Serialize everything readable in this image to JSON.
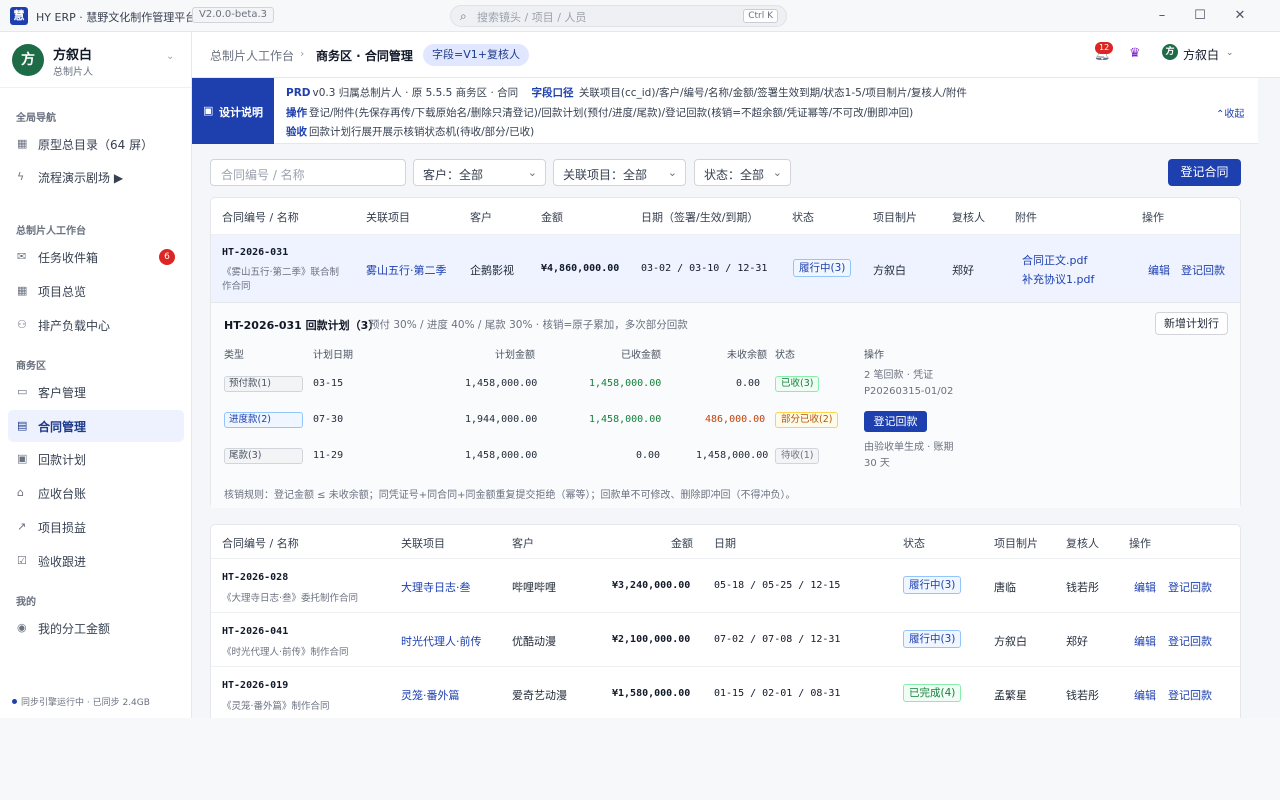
{
  "titlebar": {
    "logo": "慧",
    "title": "HY ERP · 慧野文化制作管理平台",
    "version": "V2.0.0-beta.3",
    "search_placeholder": "搜索镜头 / 项目 / 人员",
    "search_shortcut": "Ctrl K"
  },
  "sidebar": {
    "user": {
      "avatar": "方",
      "name": "方叙白",
      "role": "总制片人"
    },
    "sections": [
      {
        "title": "全局导航",
        "items": [
          {
            "icon": "grid-icon",
            "label": "原型总目录（64 屏）"
          },
          {
            "icon": "bolt-icon",
            "label": "流程演示剧场 ▶"
          }
        ]
      },
      {
        "title": "总制片人工作台",
        "items": [
          {
            "icon": "inbox-icon",
            "label": "任务收件箱",
            "badge": "6"
          },
          {
            "icon": "grid-icon",
            "label": "项目总览"
          },
          {
            "icon": "users-icon",
            "label": "排产负载中心"
          }
        ]
      },
      {
        "title": "商务区",
        "items": [
          {
            "icon": "customer-icon",
            "label": "客户管理"
          },
          {
            "icon": "contract-icon",
            "label": "合同管理",
            "active": true
          },
          {
            "icon": "calendar-icon",
            "label": "回款计划"
          },
          {
            "icon": "bank-icon",
            "label": "应收台账"
          },
          {
            "icon": "trend-icon",
            "label": "项目损益"
          },
          {
            "icon": "check-icon",
            "label": "验收跟进"
          }
        ]
      },
      {
        "title": "我的",
        "items": [
          {
            "icon": "coin-icon",
            "label": "我的分工金额"
          }
        ]
      }
    ],
    "sync_status": "同步引擎运行中 · 已同步 2.4GB"
  },
  "header": {
    "breadcrumb_parent": "总制片人工作台",
    "breadcrumb_current": "商务区 · 合同管理",
    "tag": "字段=V1+复核人",
    "notification_count": "12",
    "user_avatar": "方",
    "user_name": "方叙白"
  },
  "banner": {
    "label": "设计说明",
    "line1_key": "PRD",
    "line1": "v0.3 归属总制片人 · 原 5.5.5 商务区 · 合同",
    "line1b_key": "字段口径",
    "line1b": "关联项目(cc_id)/客户/编号/名称/金额/签署生效到期/状态1-5/项目制片/复核人/附件",
    "line2_key": "操作",
    "line2": "登记/附件(先保存再传/下载原始名/删除只清登记)/回款计划(预付/进度/尾款)/登记回款(核销=不超余额/凭证幂等/不可改/删即冲回)",
    "line3_key": "验收",
    "line3": "回款计划行展开展示核销状态机(待收/部分/已收)",
    "collapse": "收起"
  },
  "filters": {
    "search_placeholder": "合同编号 / 名称",
    "customer": "客户：全部",
    "project": "关联项目：全部",
    "status": "状态：全部",
    "add_button": "登记合同"
  },
  "table1": {
    "headers": [
      "合同编号 / 名称",
      "关联项目",
      "客户",
      "金额",
      "日期（签署/生效/到期）",
      "状态",
      "项目制片",
      "复核人",
      "附件",
      "操作"
    ],
    "row": {
      "id": "HT-2026-031",
      "name": "《雾山五行·第二季》联合制作合同",
      "project": "雾山五行·第二季",
      "customer": "企鹅影视",
      "amount": "¥4,860,000.00",
      "dates": "03-02 / 03-10 / 12-31",
      "status": "履行中(3)",
      "producer": "方叙白",
      "reviewer": "郑好",
      "attachments": [
        "合同正文.pdf",
        "补充协议1.pdf"
      ],
      "edit": "编辑",
      "register": "登记回款"
    }
  },
  "plan": {
    "title": "HT-2026-031 回款计划（3）",
    "note": "预付 30% / 进度 40% / 尾款 30% · 核销=原子累加，多次部分回款",
    "add_button": "新增计划行",
    "headers": [
      "类型",
      "计划日期",
      "计划金额",
      "已收金额",
      "未收余额",
      "状态",
      "操作"
    ],
    "rows": [
      {
        "type": "预付款(1)",
        "date": "03-15",
        "planned": "1,458,000.00",
        "received": "1,458,000.00",
        "remaining": "0.00",
        "status": "已收(3)",
        "op_line1": "2 笔回款 · 凭证",
        "op_line2": "P20260315-01/02"
      },
      {
        "type": "进度款(2)",
        "date": "07-30",
        "planned": "1,944,000.00",
        "received": "1,458,000.00",
        "remaining": "486,000.00",
        "status": "部分已收(2)",
        "op_button": "登记回款"
      },
      {
        "type": "尾款(3)",
        "date": "11-29",
        "planned": "1,458,000.00",
        "received": "0.00",
        "remaining": "1,458,000.00",
        "status": "待收(1)",
        "op_line1": "由验收单生成 · 账期",
        "op_line2": "30 天"
      }
    ],
    "rule": "核销规则：登记金额 ≤ 未收余额；同凭证号+同合同+同金额重复提交拒绝（幂等）；回款单不可修改、删除即冲回（不得冲负）。"
  },
  "table2": {
    "headers": [
      "合同编号 / 名称",
      "关联项目",
      "客户",
      "金额",
      "日期",
      "状态",
      "项目制片",
      "复核人",
      "操作"
    ],
    "rows": [
      {
        "id": "HT-2026-028",
        "name": "《大理寺日志·叁》委托制作合同",
        "project": "大理寺日志·叁",
        "customer": "哔哩哔哩",
        "amount": "¥3,240,000.00",
        "dates": "05-18 / 05-25 / 12-15",
        "status": "履行中(3)",
        "status_kind": "blue",
        "producer": "唐临",
        "reviewer": "钱若彤",
        "edit": "编辑",
        "register": "登记回款"
      },
      {
        "id": "HT-2026-041",
        "name": "《时光代理人·前传》制作合同",
        "project": "时光代理人·前传",
        "customer": "优酷动漫",
        "amount": "¥2,100,000.00",
        "dates": "07-02 / 07-08 / 12-31",
        "status": "履行中(3)",
        "status_kind": "blue",
        "producer": "方叙白",
        "reviewer": "郑好",
        "edit": "编辑",
        "register": "登记回款"
      },
      {
        "id": "HT-2026-019",
        "name": "《灵笼·番外篇》制作合同",
        "project": "灵笼·番外篇",
        "customer": "爱奇艺动漫",
        "amount": "¥1,580,000.00",
        "dates": "01-15 / 02-01 / 08-31",
        "status": "已完成(4)",
        "status_kind": "green",
        "producer": "孟繁星",
        "reviewer": "钱若彤",
        "edit": "编辑",
        "register": "登记回款"
      }
    ]
  },
  "colors": {
    "primary": "#1e40af",
    "accent_green": "#15803d",
    "accent_orange": "#c2410c",
    "danger": "#dc2626"
  }
}
